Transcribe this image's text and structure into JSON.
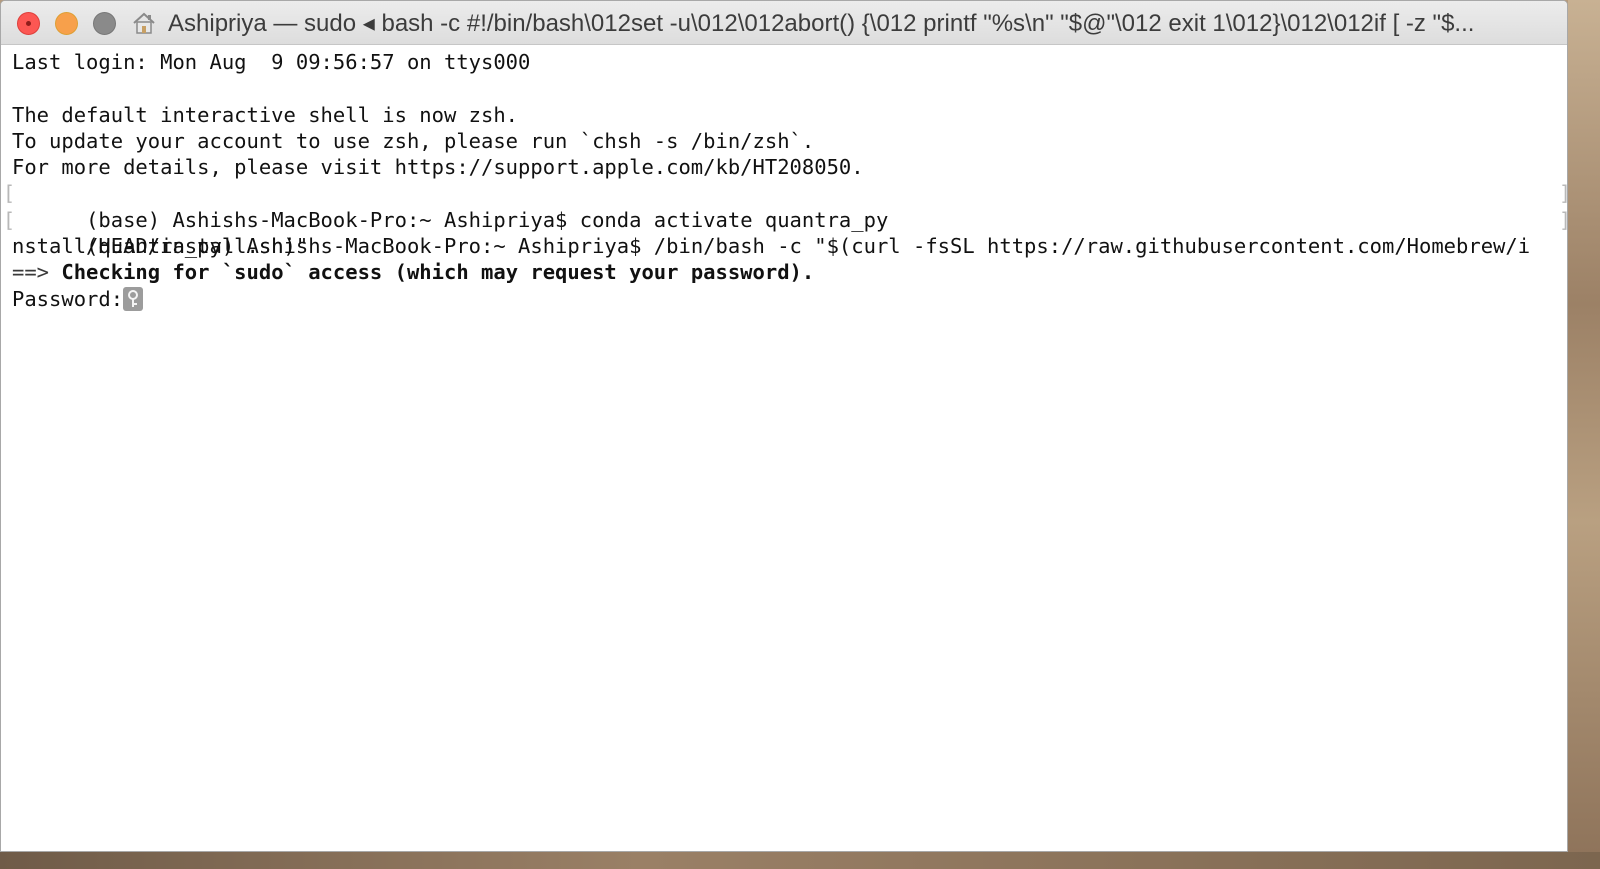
{
  "window": {
    "title": "Ashipriya — sudo ◂ bash -c #!/bin/bash\\012set -u\\012\\012abort() {\\012  printf \"%s\\n\" \"$@\"\\012  exit 1\\012}\\012\\012if [ -z \"$...",
    "icons": {
      "close": "close-icon",
      "minimize": "minimize-icon",
      "zoom": "zoom-icon",
      "home": "home-icon",
      "password_cursor": "key-icon"
    },
    "colors": {
      "close": "#fc5753",
      "minimize": "#f7a04b",
      "zoom": "#8a8a8a"
    }
  },
  "terminal": {
    "lines": [
      "Last login: Mon Aug  9 09:56:57 on ttys000",
      "",
      "The default interactive shell is now zsh.",
      "To update your account to use zsh, please run `chsh -s /bin/zsh`.",
      "For more details, please visit https://support.apple.com/kb/HT208050.",
      "(base) Ashishs-MacBook-Pro:~ Ashipriya$ conda activate quantra_py",
      "(quantra_py) Ashishs-MacBook-Pro:~ Ashipriya$ /bin/bash -c \"$(curl -fsSL https://raw.githubusercontent.com/Homebrew/i",
      "nstall/HEAD/install.sh)\"",
      "==>",
      "Checking for `sudo` access (which may request your password).",
      "Password:"
    ],
    "mark_left": "[",
    "mark_right": "]"
  }
}
